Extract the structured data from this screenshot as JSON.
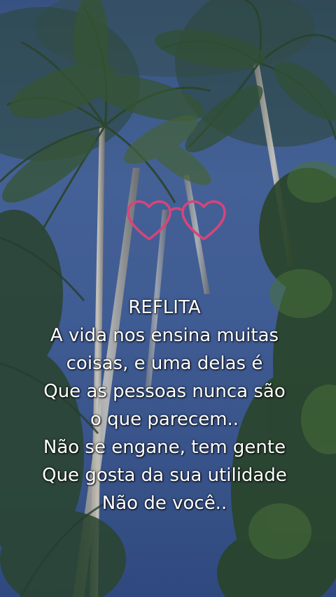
{
  "image": {
    "subject": "tall palm trees against a blue sky, viewed from below",
    "overlay_icon": "hearts-glasses-icon",
    "colors": {
      "sky": "#4a6aa3",
      "foliage": "#3d5a3a",
      "trunk": "#d9d4c8",
      "heart_stroke": "#d6457a",
      "text": "#ffffff"
    }
  },
  "quote": {
    "lines": [
      "REFLITA",
      "A vida nos ensina muitas",
      "coisas, e uma delas é",
      "Que as pessoas nunca são",
      "o que parecem..",
      "Não se engane, tem gente",
      "Que gosta da sua utilidade",
      "Não de você.."
    ]
  }
}
